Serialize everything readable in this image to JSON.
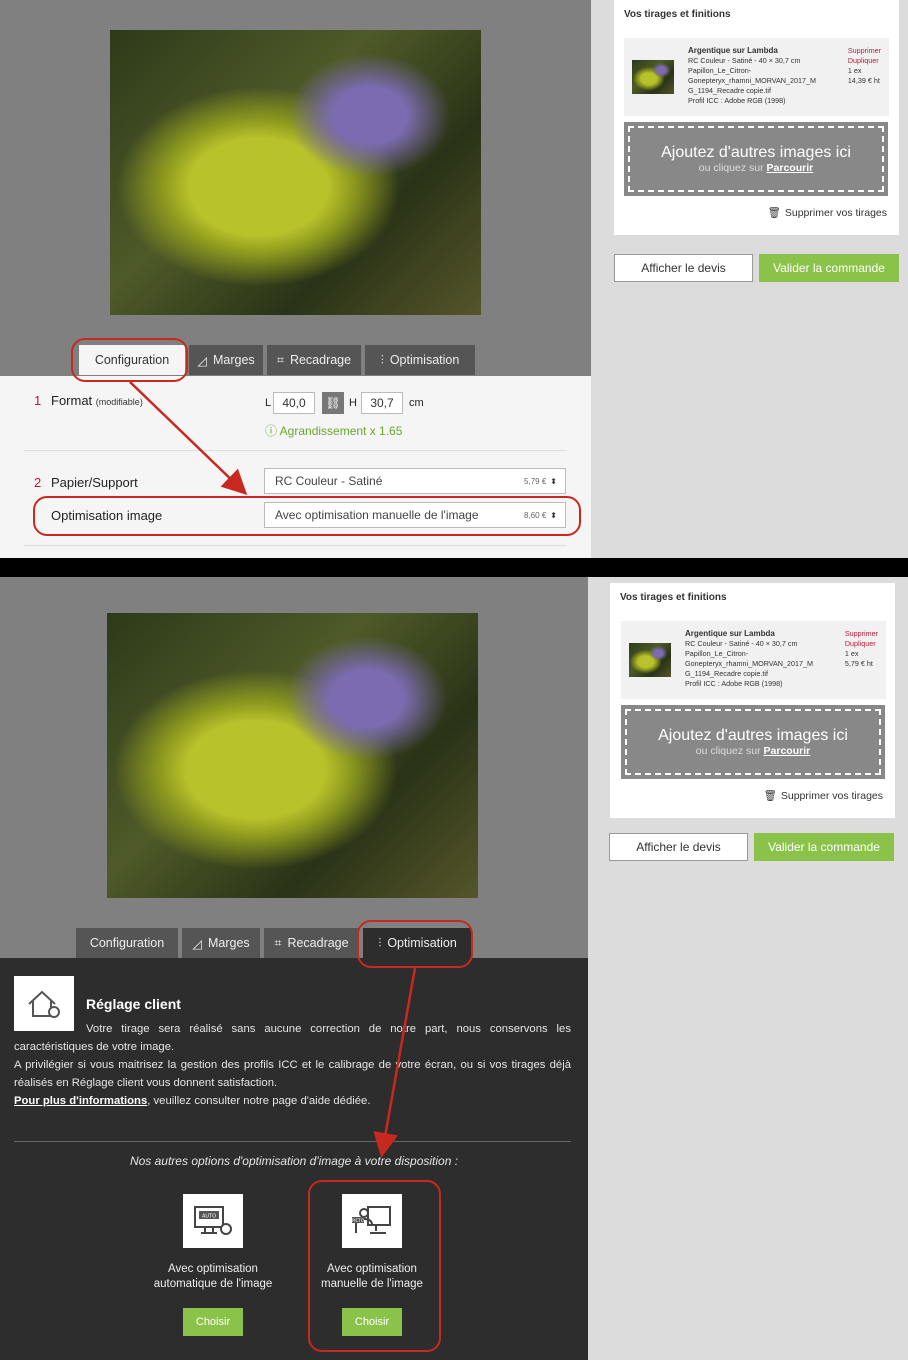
{
  "panel1": {
    "tabs": [
      {
        "label": "Configuration",
        "icon": ""
      },
      {
        "label": "Marges",
        "icon": "◿"
      },
      {
        "label": "Recadrage",
        "icon": "⌗"
      },
      {
        "label": "Optimisation",
        "icon": "⫶"
      }
    ],
    "format": {
      "num": "1",
      "label": "Format",
      "note": "(modifiable)",
      "l_label": "L",
      "l_value": "40,0",
      "h_label": "H",
      "h_value": "30,7",
      "unit": "cm",
      "enlarge": "ⓘ Agrandissement x 1.65"
    },
    "paper": {
      "num": "2",
      "label": "Papier/Support",
      "value": "RC Couleur - Satiné",
      "price": "5,79 €"
    },
    "optim": {
      "label": "Optimisation image",
      "value": "Avec optimisation manuelle de l'image",
      "price": "8,60 €"
    },
    "sidebar": {
      "tab": "Vos tirages et finitions",
      "item_title": "Argentique sur Lambda",
      "item_lines": [
        "RC Couleur - Satiné - 40 × 30,7 cm",
        "Papillon_Le_Citron-",
        "Gonepteryx_rhamni_MORVAN_2017_M",
        "G_1194_Recadre copie.tif",
        "Profil ICC : Adobe RGB (1998)"
      ],
      "delete": "Supprimer",
      "duplicate": "Dupliquer",
      "qty": "1 ex",
      "price": "14,39 € ht",
      "drop_title": "Ajoutez d'autres images ici",
      "drop_sub": "ou cliquez sur",
      "drop_link": "Parcourir",
      "delete_all": "Supprimer vos tirages",
      "quote": "Afficher le devis",
      "validate": "Valider la commande"
    }
  },
  "panel2": {
    "tabs": [
      {
        "label": "Configuration",
        "icon": ""
      },
      {
        "label": "Marges",
        "icon": "◿"
      },
      {
        "label": "Recadrage",
        "icon": "⌗"
      },
      {
        "label": "Optimisation",
        "icon": "⫶"
      }
    ],
    "heading": "Réglage client",
    "text1": "Votre tirage sera réalisé sans aucune correction de notre part, nous conservons les caractéristiques de votre image.",
    "text2": "A privilégier si vous maitrisez la gestion des profils ICC et le calibrage de votre écran, ou si vos tirages déjà réalisés en Réglage client vous donnent satisfaction.",
    "link": "Pour plus d'informations",
    "text3": ", veuillez consulter notre page d'aide dédiée.",
    "options_title": "Nos autres options d'optimisation d'image à votre disposition :",
    "opt_auto": {
      "line1": "Avec optimisation",
      "line2": "automatique de l'image",
      "icon_label": "AUTO",
      "button": "Choisir"
    },
    "opt_manual": {
      "line1": "Avec optimisation",
      "line2": "manuelle de l'image",
      "icon_label": "PICTO",
      "button": "Choisir"
    },
    "sidebar": {
      "tab": "Vos tirages et finitions",
      "item_title": "Argentique sur Lambda",
      "item_lines": [
        "RC Couleur - Satiné - 40 × 30,7 cm",
        "Papillon_Le_Citron-",
        "Gonepteryx_rhamni_MORVAN_2017_M",
        "G_1194_Recadre copie.tif",
        "Profil ICC : Adobe RGB (1998)"
      ],
      "delete": "Supprimer",
      "duplicate": "Dupliquer",
      "qty": "1 ex",
      "price": "5,79 € ht",
      "drop_title": "Ajoutez d'autres images ici",
      "drop_sub": "ou cliquez sur",
      "drop_link": "Parcourir",
      "delete_all": "Supprimer vos tirages",
      "quote": "Afficher le devis",
      "validate": "Valider la commande"
    }
  },
  "colors": {
    "accent_green": "#8bc34a",
    "highlight_red": "#c8291e",
    "danger": "#b81b3a"
  }
}
